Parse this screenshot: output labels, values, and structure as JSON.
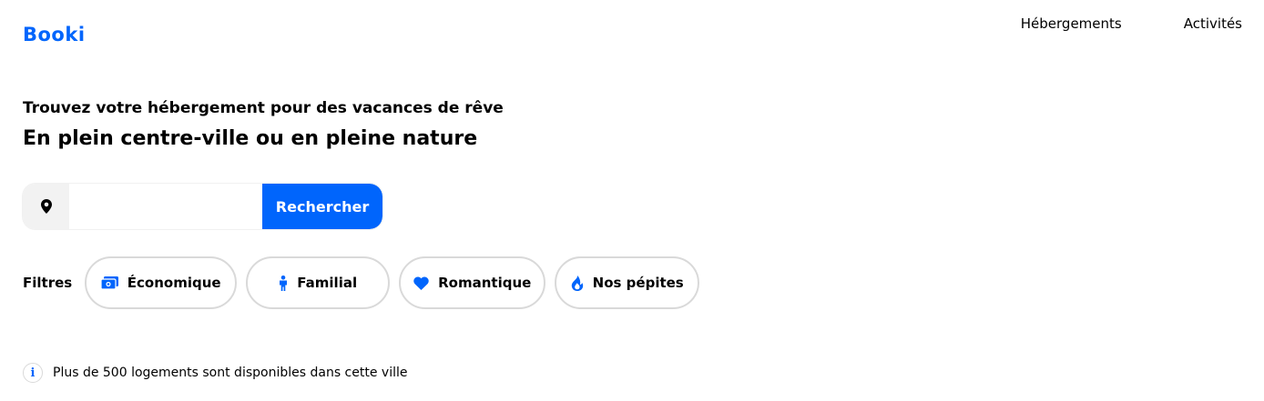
{
  "header": {
    "logo": "Booki",
    "nav": [
      "Hébergements",
      "Activités"
    ]
  },
  "hero": {
    "subtitle": "Trouvez votre hébergement pour des vacances de rêve",
    "title": "En plein centre-ville ou en pleine nature"
  },
  "search": {
    "value": "",
    "placeholder": "",
    "button_label": "Rechercher",
    "icon": "location-pin-icon"
  },
  "filters": {
    "label": "Filtres",
    "items": [
      {
        "label": "Économique",
        "icon": "money-icon"
      },
      {
        "label": "Familial",
        "icon": "child-icon"
      },
      {
        "label": "Romantique",
        "icon": "heart-icon"
      },
      {
        "label": "Nos pépites",
        "icon": "fire-icon"
      }
    ]
  },
  "info": {
    "icon": "info-icon",
    "symbol": "i",
    "text": "Plus de 500 logements sont disponibles dans cette ville"
  },
  "colors": {
    "accent": "#0065fc",
    "border": "#d9d9d9",
    "input_icon_bg": "#f2f2f2"
  }
}
